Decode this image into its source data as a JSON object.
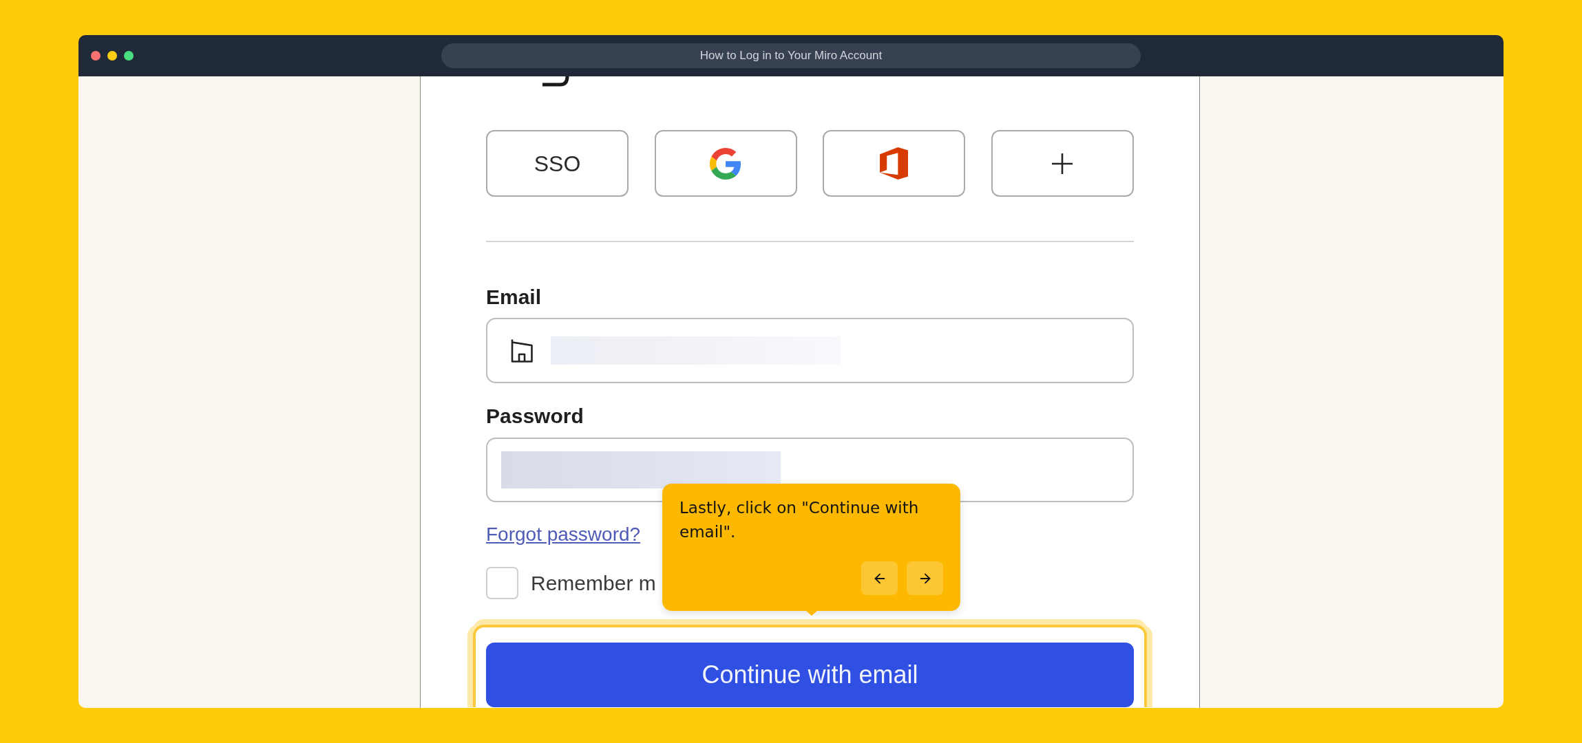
{
  "window": {
    "title": "How to Log in to Your Miro Account"
  },
  "login": {
    "sign_in_options": [
      {
        "kind": "sso",
        "label": "SSO"
      },
      {
        "kind": "google"
      },
      {
        "kind": "office"
      },
      {
        "kind": "more"
      }
    ],
    "email": {
      "label": "Email",
      "redacted": true
    },
    "password": {
      "label": "Password",
      "redacted": true
    },
    "forgot_link": "Forgot password?",
    "remember": {
      "label": "Remember m",
      "checked": false
    },
    "submit": {
      "label": "Continue with email",
      "highlighted": true
    }
  },
  "tooltip": {
    "text": "Lastly, click on \"Continue with email\".",
    "buttons": [
      {
        "kind": "back"
      },
      {
        "kind": "next"
      }
    ]
  }
}
